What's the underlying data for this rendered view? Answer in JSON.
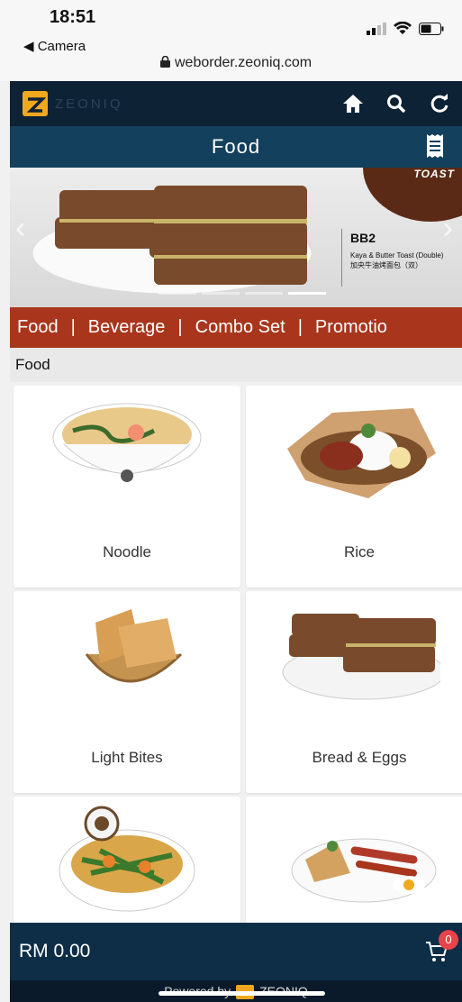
{
  "status_bar": {
    "time": "18:51",
    "back_app": "◀ Camera",
    "url": "weborder.zeoniq.com"
  },
  "topnav": {
    "brand": "ZEONIQ",
    "icons": [
      "home-icon",
      "search-icon",
      "refresh-icon"
    ]
  },
  "titlebar": {
    "title": "Food",
    "receipt_icon": "receipt-icon"
  },
  "banner": {
    "corner_text": "TOAST",
    "code": "BB2",
    "desc_en": "Kaya & Butter Toast (Double)",
    "desc_zh": "加央牛油烤面包（双）",
    "slides": 4,
    "active_slide": 3
  },
  "categories": [
    "Food",
    "Beverage",
    "Combo Set",
    "Promotio"
  ],
  "category_separator": "|",
  "section_title": "Food",
  "items": [
    {
      "label": "Noodle"
    },
    {
      "label": "Rice"
    },
    {
      "label": "Light Bites"
    },
    {
      "label": "Bread & Eggs"
    },
    {
      "label": ""
    },
    {
      "label": ""
    }
  ],
  "cart": {
    "total": "RM 0.00",
    "count": "0"
  },
  "footer": {
    "powered_by": "Powered by",
    "brand": "ZEONIQ"
  },
  "colors": {
    "nav": "#0e2236",
    "title": "#12405d",
    "category": "#a8351c",
    "bottom": "#0e2e48",
    "badge": "#e8424a"
  }
}
